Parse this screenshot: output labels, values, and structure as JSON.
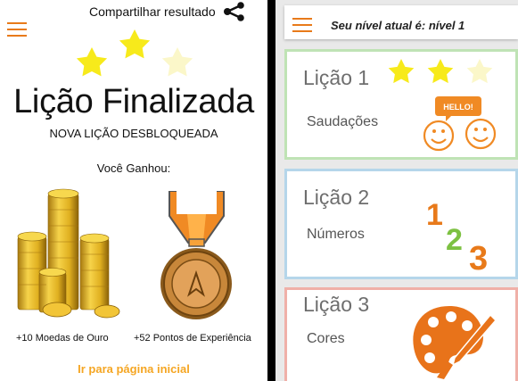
{
  "result_screen": {
    "share_label": "Compartilhar resultado",
    "stars_earned": 2,
    "stars_total": 3,
    "title": "Lição Finalizada",
    "unlocked_text": "NOVA LIÇÃO DESBLOQUEADA",
    "won_label": "Você Ganhou:",
    "rewards": [
      {
        "label": "+10 Moedas de Ouro",
        "icon": "gold-coins-icon"
      },
      {
        "label": "+52 Pontos de Experiência",
        "icon": "medal-icon"
      }
    ],
    "home_link": "Ir para página inicial"
  },
  "lesson_list": {
    "level_text": "Seu nível atual é: nível 1",
    "lessons": [
      {
        "title": "Lição 1",
        "subtitle": "Saudações",
        "stars_earned": 2,
        "stars_total": 3,
        "icon": "greeting-faces-icon",
        "bubble_text": "HELLO!",
        "accent": "#bfe3b5"
      },
      {
        "title": "Lição 2",
        "subtitle": "Números",
        "icon": "numbers-icon",
        "digits": [
          "1",
          "2",
          "3"
        ],
        "accent": "#b5d6ea"
      },
      {
        "title": "Lição 3",
        "subtitle": "Cores",
        "icon": "paint-palette-icon",
        "accent": "#f0b0a8"
      }
    ]
  },
  "colors": {
    "accent_orange": "#e87a1a",
    "star_yellow": "#f7ea1b",
    "star_empty": "#fbf7c9",
    "link_orange": "#f5a623",
    "digit_green": "#7dc142"
  }
}
